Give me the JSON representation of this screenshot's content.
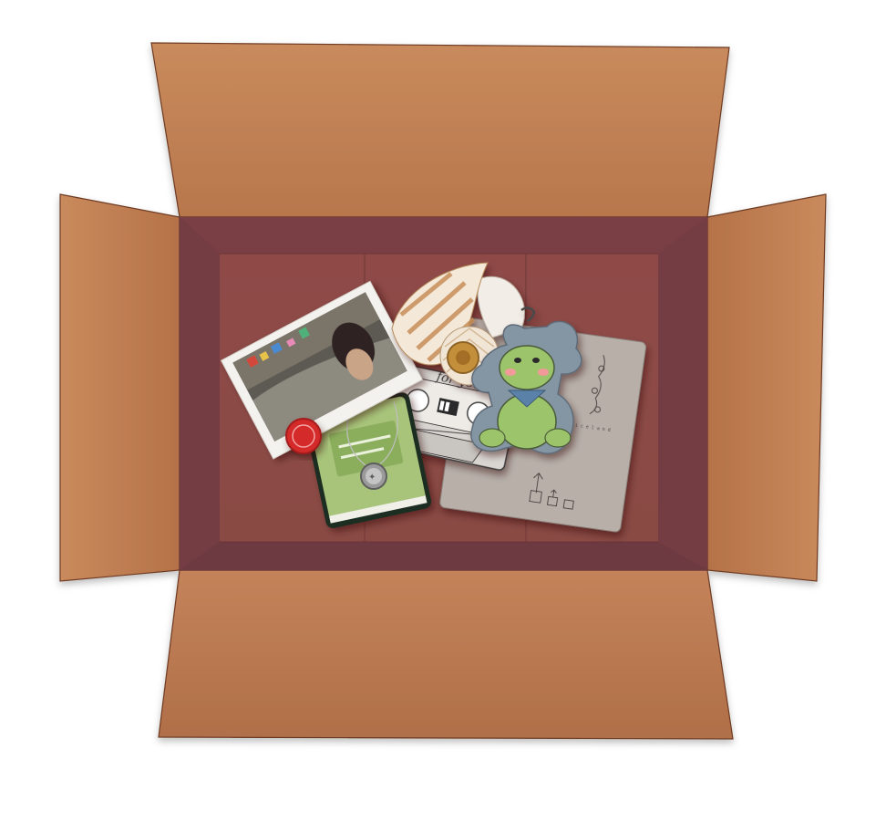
{
  "colors": {
    "flap_light": "#c98a5c",
    "flap_dark": "#a86842",
    "flap_edge": "#6e3a22",
    "box_inner": "#7a3f45",
    "box_floor": "#8d4a48",
    "frog_green": "#9cc46a",
    "frog_backing": "#8495a4",
    "notebook_green": "#a8c47a",
    "seal_red": "#d52b2b"
  },
  "items": {
    "cassette_label": "for you",
    "notebook_label": "i c e l a n d"
  },
  "icons": [
    "frog-keychain",
    "seashell",
    "cassette-tape",
    "photo-print",
    "green-notebook",
    "pendant-necklace",
    "sketch-notebook",
    "wax-seal"
  ]
}
